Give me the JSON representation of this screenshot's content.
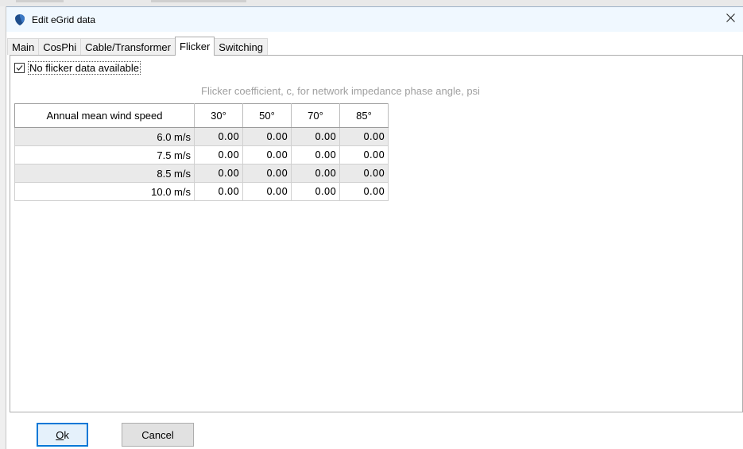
{
  "window": {
    "title": "Edit eGrid data",
    "close_glyph": "✕"
  },
  "tabs": [
    {
      "label": "Main"
    },
    {
      "label": "CosPhi"
    },
    {
      "label": "Cable/Transformer"
    },
    {
      "label": "Flicker",
      "active": true
    },
    {
      "label": "Switching"
    }
  ],
  "flicker": {
    "no_data_label": "No flicker data available",
    "no_data_checked": true,
    "caption": "Flicker coefficient, c, for network impedance phase angle, psi",
    "header": {
      "row_label": "Annual mean wind speed",
      "angles": [
        "30°",
        "50°",
        "70°",
        "85°"
      ]
    },
    "rows": [
      {
        "speed": "6.0 m/s",
        "values": [
          "0.00",
          "0.00",
          "0.00",
          "0.00"
        ]
      },
      {
        "speed": "7.5 m/s",
        "values": [
          "0.00",
          "0.00",
          "0.00",
          "0.00"
        ]
      },
      {
        "speed": "8.5 m/s",
        "values": [
          "0.00",
          "0.00",
          "0.00",
          "0.00"
        ]
      },
      {
        "speed": "10.0 m/s",
        "values": [
          "0.00",
          "0.00",
          "0.00",
          "0.00"
        ]
      }
    ]
  },
  "buttons": {
    "ok_label": "Ok",
    "ok_mnemonic": "O",
    "ok_rest": "k",
    "cancel_label": "Cancel"
  },
  "icons": {
    "app": "app-shield-icon",
    "close": "close-icon",
    "check": "checkmark-icon"
  },
  "colors": {
    "titlebar": "#f0f8ff",
    "app_icon": "#1f4e8c",
    "ok_border": "#0078d7",
    "row_shade": "#eaeaea"
  }
}
